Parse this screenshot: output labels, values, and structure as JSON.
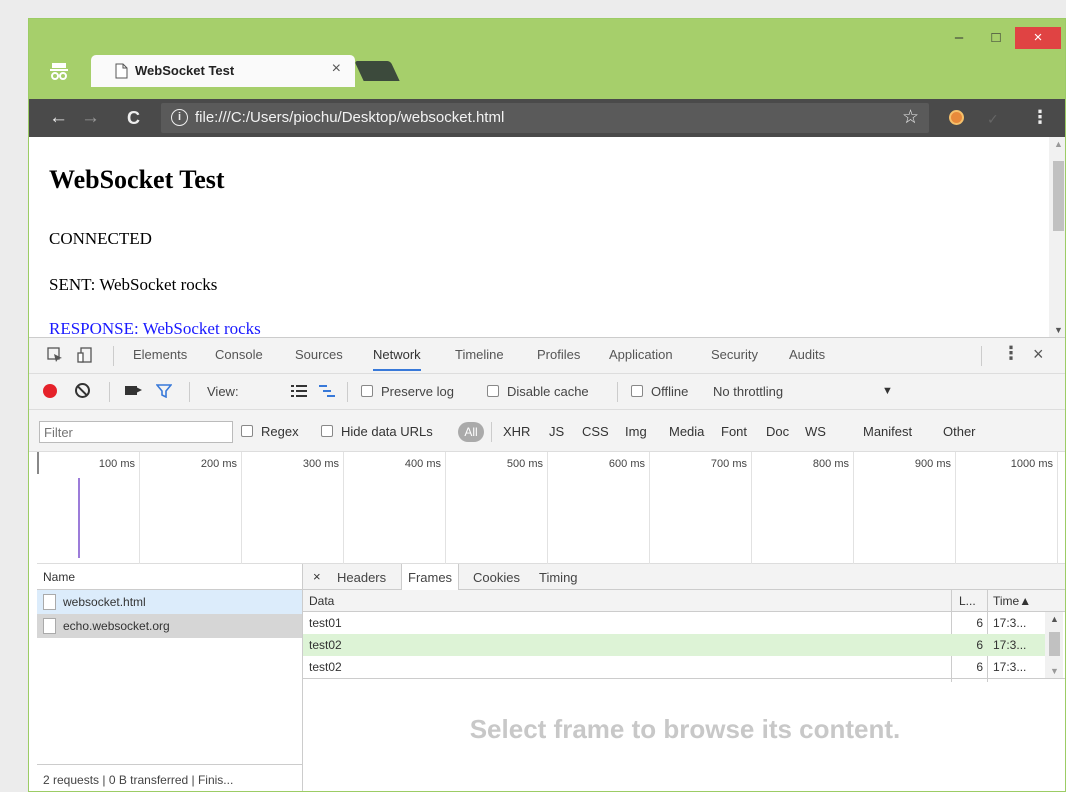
{
  "window": {
    "tab_title": "WebSocket Test",
    "tab_close": "×",
    "min": "–",
    "max": "□",
    "close": "×"
  },
  "toolbar": {
    "back": "←",
    "forward": "→",
    "reload": "C",
    "url": "file:///C:/Users/piochu/Desktop/websocket.html",
    "star": "☆",
    "info": "i",
    "menu": "⋮",
    "ext2": "✓"
  },
  "page": {
    "heading": "WebSocket Test",
    "lines": [
      "CONNECTED",
      "SENT: WebSocket rocks",
      "RESPONSE: WebSocket rocks"
    ]
  },
  "devtools": {
    "tabs": [
      "Elements",
      "Console",
      "Sources",
      "Network",
      "Timeline",
      "Profiles",
      "Application",
      "Security",
      "Audits"
    ],
    "active_tab": "Network",
    "more": "⋮",
    "close": "×",
    "bar2": {
      "view_label": "View:",
      "preserve_log": "Preserve log",
      "disable_cache": "Disable cache",
      "offline": "Offline",
      "throttling": "No throttling",
      "arrow": "▼"
    },
    "filter": {
      "placeholder": "Filter",
      "regex": "Regex",
      "hide_data_urls": "Hide data URLs",
      "all": "All",
      "types": [
        "XHR",
        "JS",
        "CSS",
        "Img",
        "Media",
        "Font",
        "Doc",
        "WS",
        "Manifest",
        "Other"
      ]
    },
    "timeline": {
      "ticks": [
        "100 ms",
        "200 ms",
        "300 ms",
        "400 ms",
        "500 ms",
        "600 ms",
        "700 ms",
        "800 ms",
        "900 ms",
        "1000 ms"
      ]
    },
    "requests": {
      "header": "Name",
      "items": [
        "websocket.html",
        "echo.websocket.org"
      ],
      "footer": "2 requests | 0 B transferred | Finis..."
    },
    "frames": {
      "close": "×",
      "tabs": [
        "Headers",
        "Frames",
        "Cookies",
        "Timing"
      ],
      "active_tab": "Frames",
      "columns": [
        "Data",
        "L...",
        "Time▲"
      ],
      "rows": [
        {
          "data": "test01",
          "length": "6",
          "time": "17:3...",
          "scroll": "▲"
        },
        {
          "data": "test02",
          "length": "6",
          "time": "17:3..."
        },
        {
          "data": "test02",
          "length": "6",
          "time": "17:3...",
          "scroll": "▼"
        }
      ],
      "placeholder": "Select frame to browse its content."
    }
  },
  "colors": {
    "frame_green": "#a6cf6b",
    "toolbar_dark": "#4a4a4a",
    "record_red": "#e5222a",
    "link_blue": "#1a1aff",
    "selected_row": "#ddf3d6"
  }
}
